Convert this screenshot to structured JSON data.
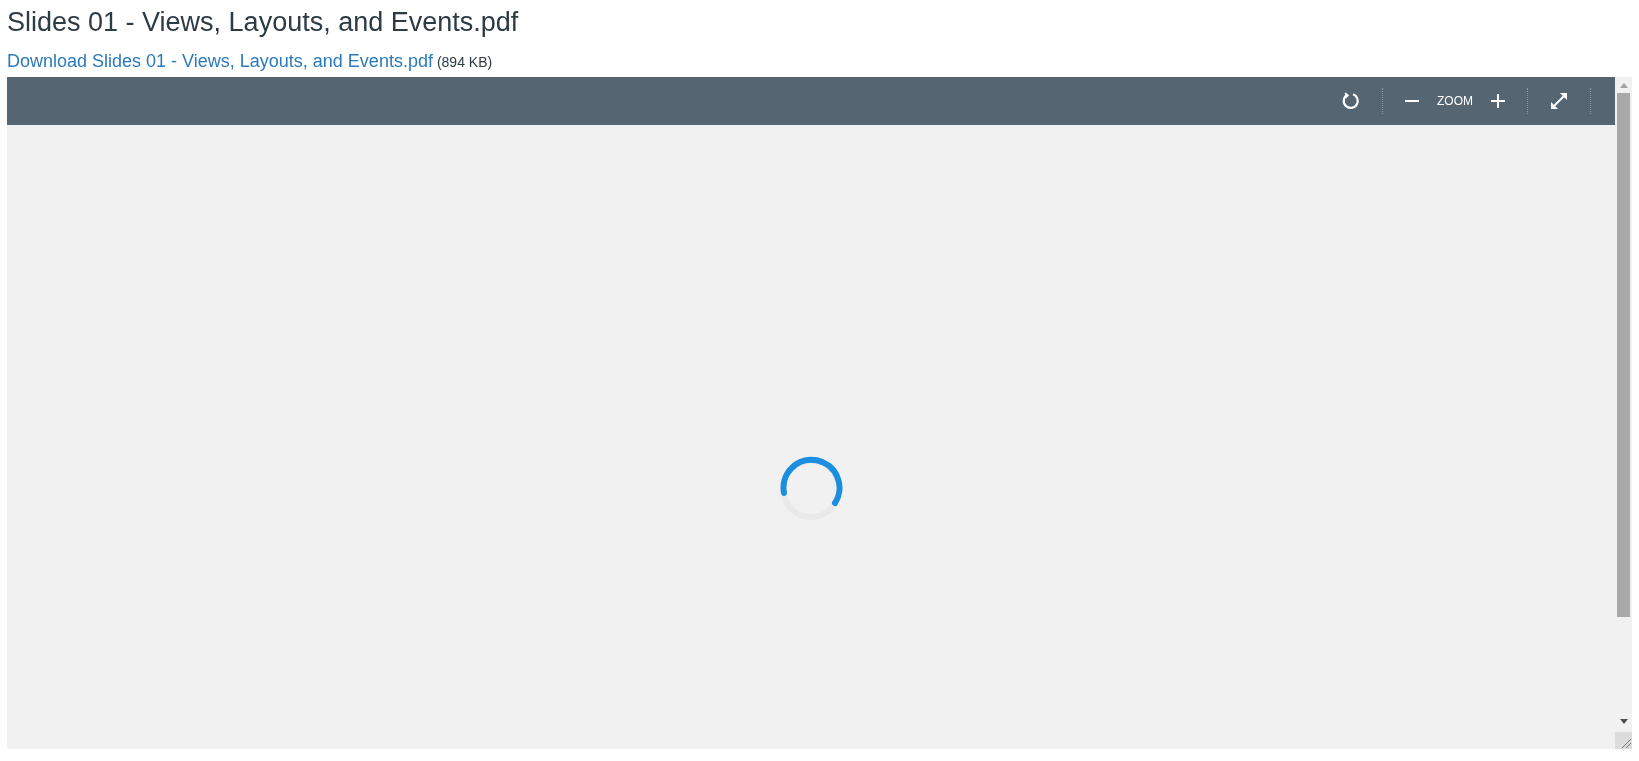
{
  "title": "Slides 01 - Views, Layouts, and Events.pdf",
  "download": {
    "link": "Download Slides 01 - Views, Layouts, and Events.pdf",
    "size": "(894 KB)"
  },
  "toolbar": {
    "zoom_label": "ZOOM"
  }
}
